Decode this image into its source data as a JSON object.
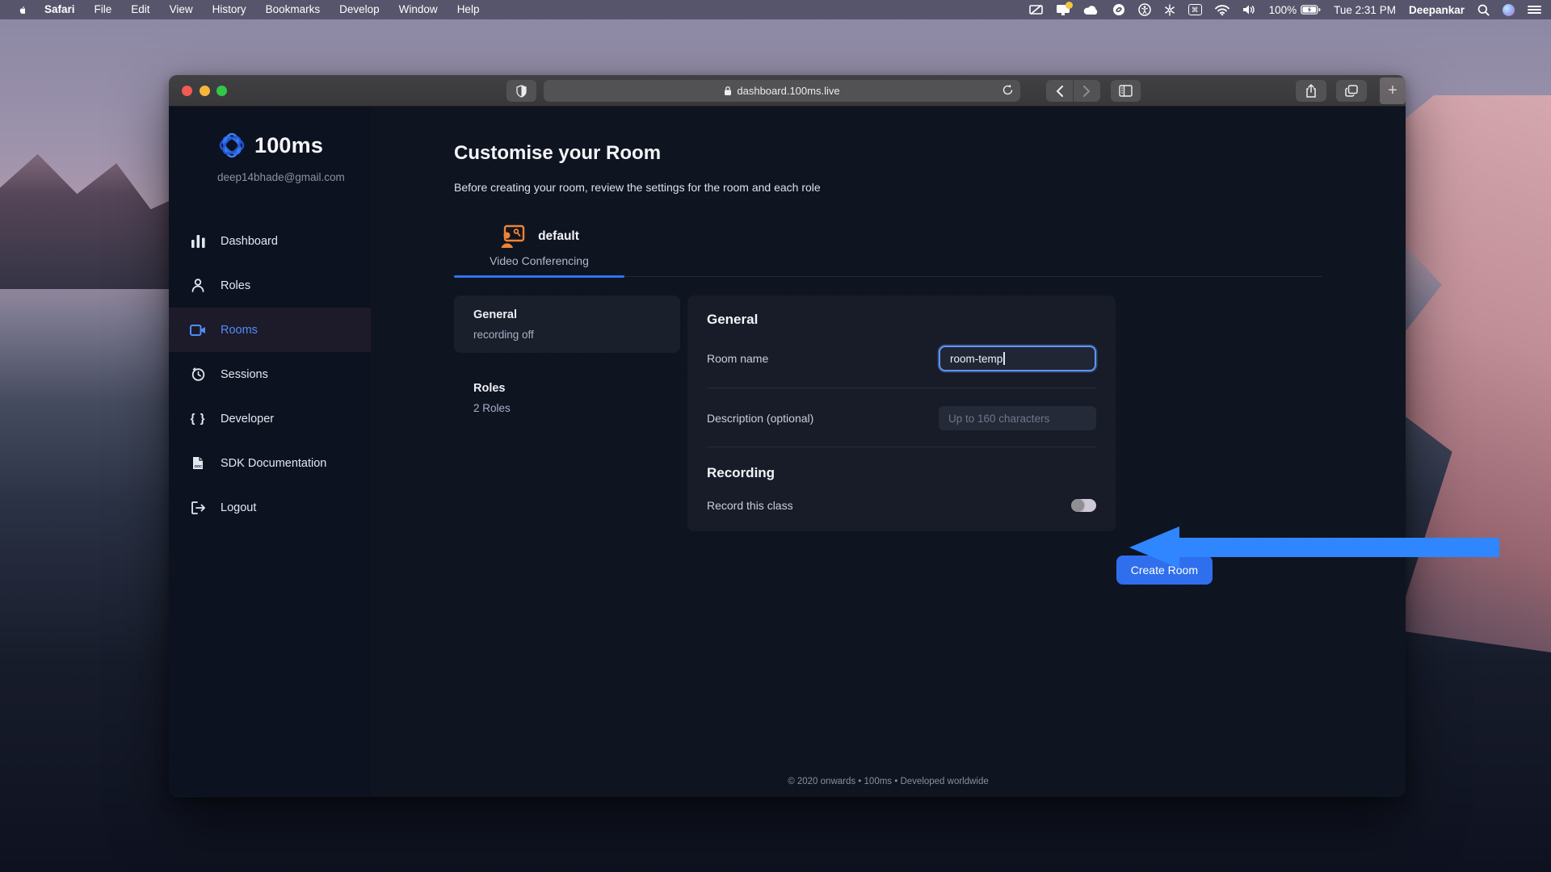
{
  "colors": {
    "accent_blue": "#2f6fed",
    "arrow_blue": "#2f86ff",
    "active_nav_blue": "#4f8df7",
    "tab_icon_orange": "#ee8436",
    "focus_ring": "#5f95f6"
  },
  "menu_bar": {
    "items": [
      "Safari",
      "File",
      "Edit",
      "View",
      "History",
      "Bookmarks",
      "Develop",
      "Window",
      "Help"
    ],
    "status_icons": [
      "display-slash-icon",
      "display-alert-icon",
      "cloud-icon",
      "shazam-icon",
      "accessibility-icon",
      "bluetooth-icon",
      "keyboard-viewer-icon",
      "wifi-icon",
      "volume-icon",
      "battery-icon",
      "spotlight-search-icon",
      "siri-icon",
      "notification-center-icon"
    ],
    "status": {
      "battery_percent": "100%",
      "clock": "Tue 2:31 PM",
      "user": "Deepankar",
      "keyboard_glyph": "⌘"
    }
  },
  "browser": {
    "url": "dashboard.100ms.live",
    "newtab_label": "+"
  },
  "sidebar": {
    "brand": "100ms",
    "email": "deep14bhade@gmail.com",
    "items": [
      {
        "label": "Dashboard",
        "icon": "bar-chart-icon",
        "active": false
      },
      {
        "label": "Roles",
        "icon": "person-icon",
        "active": false
      },
      {
        "label": "Rooms",
        "icon": "video-camera-icon",
        "active": true
      },
      {
        "label": "Sessions",
        "icon": "alarm-clock-icon",
        "active": false
      },
      {
        "label": "Developer",
        "icon": "code-braces-icon",
        "active": false
      },
      {
        "label": "SDK Documentation",
        "icon": "document-icon",
        "active": false
      },
      {
        "label": "Logout",
        "icon": "logout-icon",
        "active": false
      }
    ],
    "braces_glyph": "{ }"
  },
  "main": {
    "title": "Customise your Room",
    "subtitle": "Before creating your room, review the settings for the room and each role",
    "tab": {
      "name": "default",
      "type": "Video Conferencing",
      "icon": "presenter-icon"
    },
    "settings_nav": [
      {
        "title": "General",
        "subtitle": "recording off",
        "active": true
      },
      {
        "title": "Roles",
        "subtitle": "2 Roles",
        "active": false
      }
    ],
    "general": {
      "heading": "General",
      "room_name_label": "Room name",
      "room_name_value": "room-temp",
      "description_label": "Description (optional)",
      "description_placeholder": "Up to 160 characters"
    },
    "recording": {
      "heading": "Recording",
      "toggle_label": "Record this class",
      "toggle_state": "off"
    },
    "create_button": "Create Room",
    "footer": "© 2020 onwards • 100ms • Developed worldwide"
  }
}
